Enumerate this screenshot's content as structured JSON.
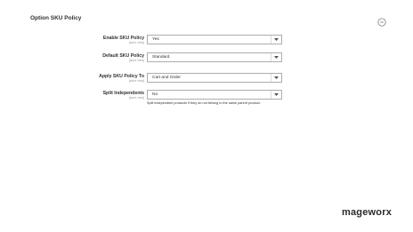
{
  "section": {
    "title": "Option SKU Policy"
  },
  "fields": [
    {
      "label": "Enable SKU Policy",
      "scope": "[store view]",
      "value": "Yes",
      "note": ""
    },
    {
      "label": "Default SKU Policy",
      "scope": "[store view]",
      "value": "Standard",
      "note": ""
    },
    {
      "label": "Apply SKU Policy To",
      "scope": "[store view]",
      "value": "Cart and Order",
      "note": ""
    },
    {
      "label": "Split Independents",
      "scope": "[store view]",
      "value": "No",
      "note": "Split independent products if they do not belong to the same parent product."
    }
  ],
  "brand": {
    "logo_text": "mageworx"
  },
  "icons": {
    "collapse": "collapse-circle-icon",
    "dropdown": "chevron-down-icon"
  }
}
